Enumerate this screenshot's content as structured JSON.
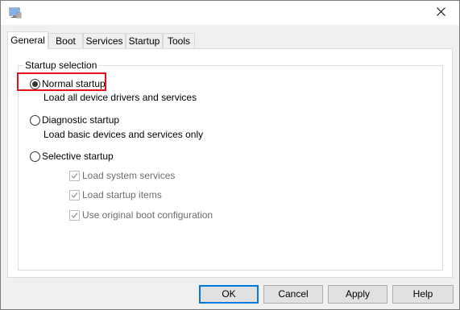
{
  "window": {
    "title": ""
  },
  "tabs": [
    {
      "label": "General",
      "active": true
    },
    {
      "label": "Boot",
      "active": false
    },
    {
      "label": "Services",
      "active": false
    },
    {
      "label": "Startup",
      "active": false
    },
    {
      "label": "Tools",
      "active": false
    }
  ],
  "startup_selection": {
    "group_label": "Startup selection",
    "options": [
      {
        "label": "Normal startup",
        "description": "Load all device drivers and services",
        "selected": true
      },
      {
        "label": "Diagnostic startup",
        "description": "Load basic devices and services only",
        "selected": false
      },
      {
        "label": "Selective startup",
        "description": "",
        "selected": false
      }
    ],
    "selective_items": [
      {
        "label": "Load system services",
        "checked": true,
        "enabled": false
      },
      {
        "label": "Load startup items",
        "checked": true,
        "enabled": false
      },
      {
        "label": "Use original boot configuration",
        "checked": true,
        "enabled": false
      }
    ]
  },
  "buttons": {
    "ok": "OK",
    "cancel": "Cancel",
    "apply": "Apply",
    "help": "Help"
  },
  "colors": {
    "highlight_box": "#e3121a",
    "default_button_border": "#0078d7"
  },
  "icons": {
    "app": "msconfig-app-icon",
    "close": "close-icon"
  }
}
